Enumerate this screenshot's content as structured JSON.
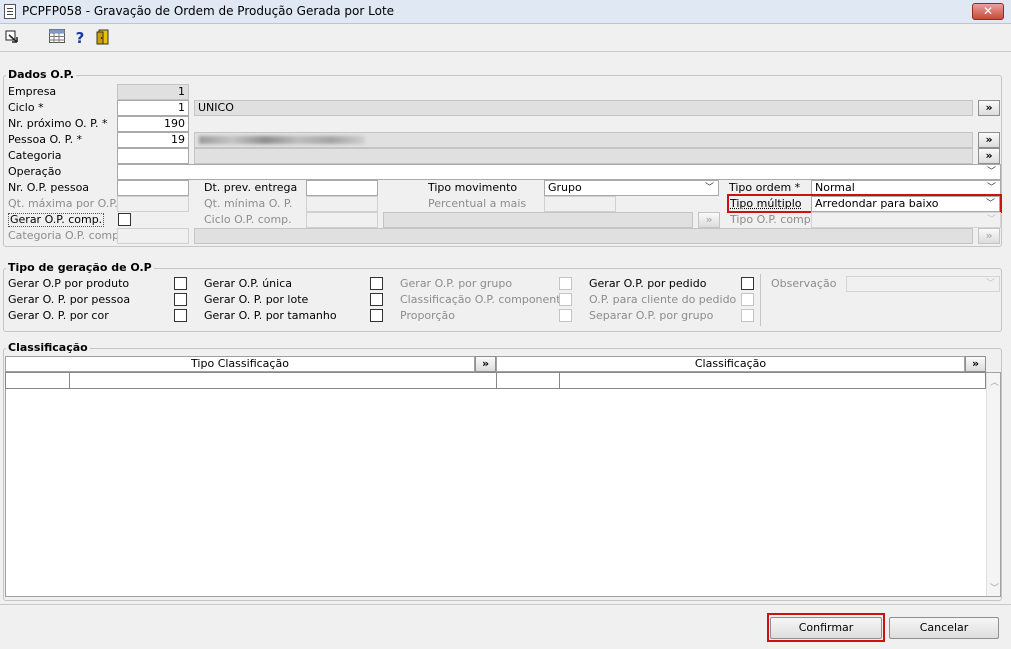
{
  "window": {
    "title": "PCPFP058 - Gravação de Ordem de Produção Gerada por Lote",
    "close_label": "✕"
  },
  "toolbar": {
    "exit_icon": "exit-icon",
    "grid_icon": "grid-icon",
    "help_label": "?",
    "door_icon": "door-icon"
  },
  "dados": {
    "title": "Dados O.P.",
    "empresa_label": "Empresa",
    "empresa_value": "1",
    "ciclo_label": "Ciclo *",
    "ciclo_value": "1",
    "ciclo_desc": "UNICO",
    "nr_proximo_label": "Nr. próximo O. P. *",
    "nr_proximo_value": "190",
    "pessoa_label": "Pessoa O. P. *",
    "pessoa_value": "19",
    "categoria_label": "Categoria",
    "operacao_label": "Operação",
    "nr_op_pessoa_label": "Nr. O.P. pessoa",
    "dt_prev_label": "Dt. prev. entrega",
    "tipo_mov_label": "Tipo movimento",
    "tipo_mov_value": "Grupo",
    "tipo_ordem_label": "Tipo ordem *",
    "tipo_ordem_value": "Normal",
    "qt_max_label": "Qt. máxima por O.P.",
    "qt_min_label": "Qt. mínima O. P.",
    "percentual_label": "Percentual a mais",
    "tipo_multiplo_label": "Tipo múltiplo",
    "tipo_multiplo_value": "Arredondar para baixo",
    "gerar_comp_label": "Gerar O.P. comp.",
    "ciclo_comp_label": "Ciclo O.P. comp.",
    "tipo_op_comp_label": "Tipo O.P. comp.",
    "categoria_comp_label": "Categoria O.P. comp.",
    "search_label": "»"
  },
  "geracao": {
    "title": "Tipo de geração de O.P",
    "col1": [
      "Gerar O.P por produto",
      "Gerar O. P. por pessoa",
      "Gerar O. P. por cor"
    ],
    "col2": [
      "Gerar O.P. única",
      "Gerar O. P. por lote",
      "Gerar O. P. por tamanho"
    ],
    "col3": [
      "Gerar O.P. por grupo",
      "Classificação O.P. componente",
      "Proporção"
    ],
    "col4": [
      "Gerar O.P. por pedido",
      "O.P. para cliente do pedido",
      "Separar  O.P. por grupo"
    ],
    "observacao_label": "Observação"
  },
  "classificacao": {
    "title": "Classificação",
    "col_tipo": "Tipo Classificação",
    "col_class": "Classificação"
  },
  "footer": {
    "confirm_label": "Confirmar",
    "cancel_label": "Cancelar"
  }
}
